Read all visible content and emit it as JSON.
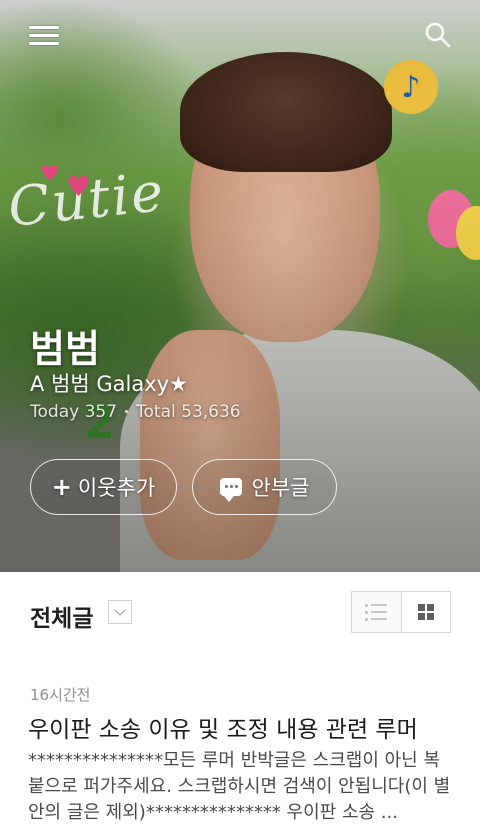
{
  "top_bar": {
    "menu_icon": "hamburger-menu-icon",
    "search_icon": "search-icon"
  },
  "blog": {
    "name": "범범",
    "description": "A 범범 Galaxy★",
    "today_label": "Today 357",
    "total_label": "Total 53,636"
  },
  "actions": {
    "add_neighbor_label": "이웃추가",
    "guestbook_label": "안부글"
  },
  "content": {
    "section_title": "전체글",
    "view_modes": [
      "list-view",
      "grid-view"
    ],
    "selected_view": "grid-view"
  },
  "post": {
    "time": "16시간전",
    "title": "우이판 소송 이유 및 조정 내용 관련 루머",
    "excerpt": "***************모든 루머 반박글은 스크랩이 아닌 복붙으로 퍼가주세요. 스크랩하시면 검색이 안됩니다(이 별 안의 글은 제외)*************** 우이판 소송 ..."
  }
}
